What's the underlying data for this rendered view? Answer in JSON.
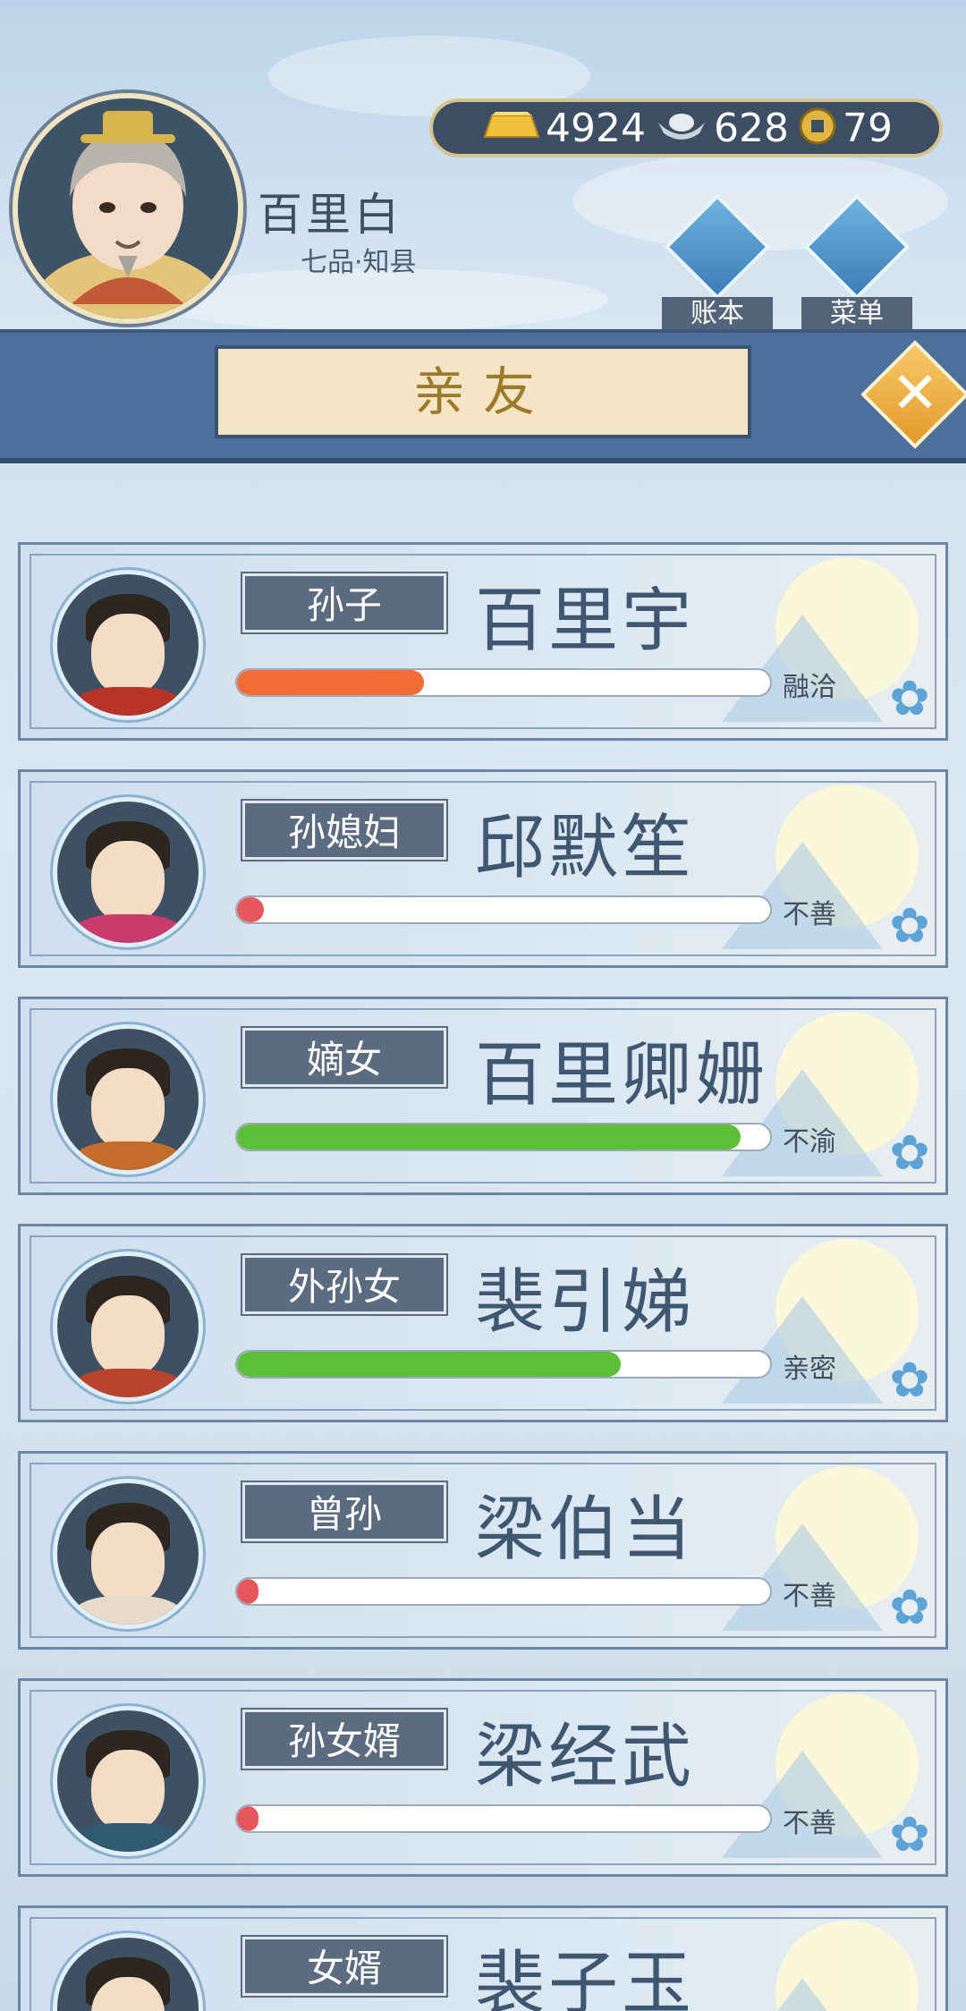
{
  "header": {
    "player_name": "百里白",
    "player_rank": "七品·知县",
    "currency": {
      "gold": "4924",
      "silver": "628",
      "coin": "79"
    },
    "buttons": {
      "ledger": "账本",
      "menu": "菜单"
    },
    "title": "亲友"
  },
  "relatives": [
    {
      "relation": "孙子",
      "name": "百里宇",
      "status": "融洽",
      "affinity": 0.35,
      "bar_color": "#f36b36",
      "robe": "#b83428"
    },
    {
      "relation": "孙媳妇",
      "name": "邱默笙",
      "status": "不善",
      "affinity": 0.05,
      "bar_color": "#e5575b",
      "robe": "#c93a6c"
    },
    {
      "relation": "嫡女",
      "name": "百里卿姗",
      "status": "不渝",
      "affinity": 0.945,
      "bar_color": "#5cbf38",
      "robe": "#c46c2a"
    },
    {
      "relation": "外孙女",
      "name": "裴引娣",
      "status": "亲密",
      "affinity": 0.72,
      "bar_color": "#5cbf38",
      "robe": "#b8452b"
    },
    {
      "relation": "曾孙",
      "name": "梁伯当",
      "status": "不善",
      "affinity": 0.03,
      "bar_color": "#e5575b",
      "robe": "#e8d9c8"
    },
    {
      "relation": "孙女婿",
      "name": "梁经武",
      "status": "不善",
      "affinity": 0.03,
      "bar_color": "#e5575b",
      "robe": "#2f5a72"
    },
    {
      "relation": "女婿",
      "name": "裴子玉",
      "status": "",
      "affinity": 0.0,
      "bar_color": "#e5575b",
      "robe": "#3a4d60"
    }
  ]
}
